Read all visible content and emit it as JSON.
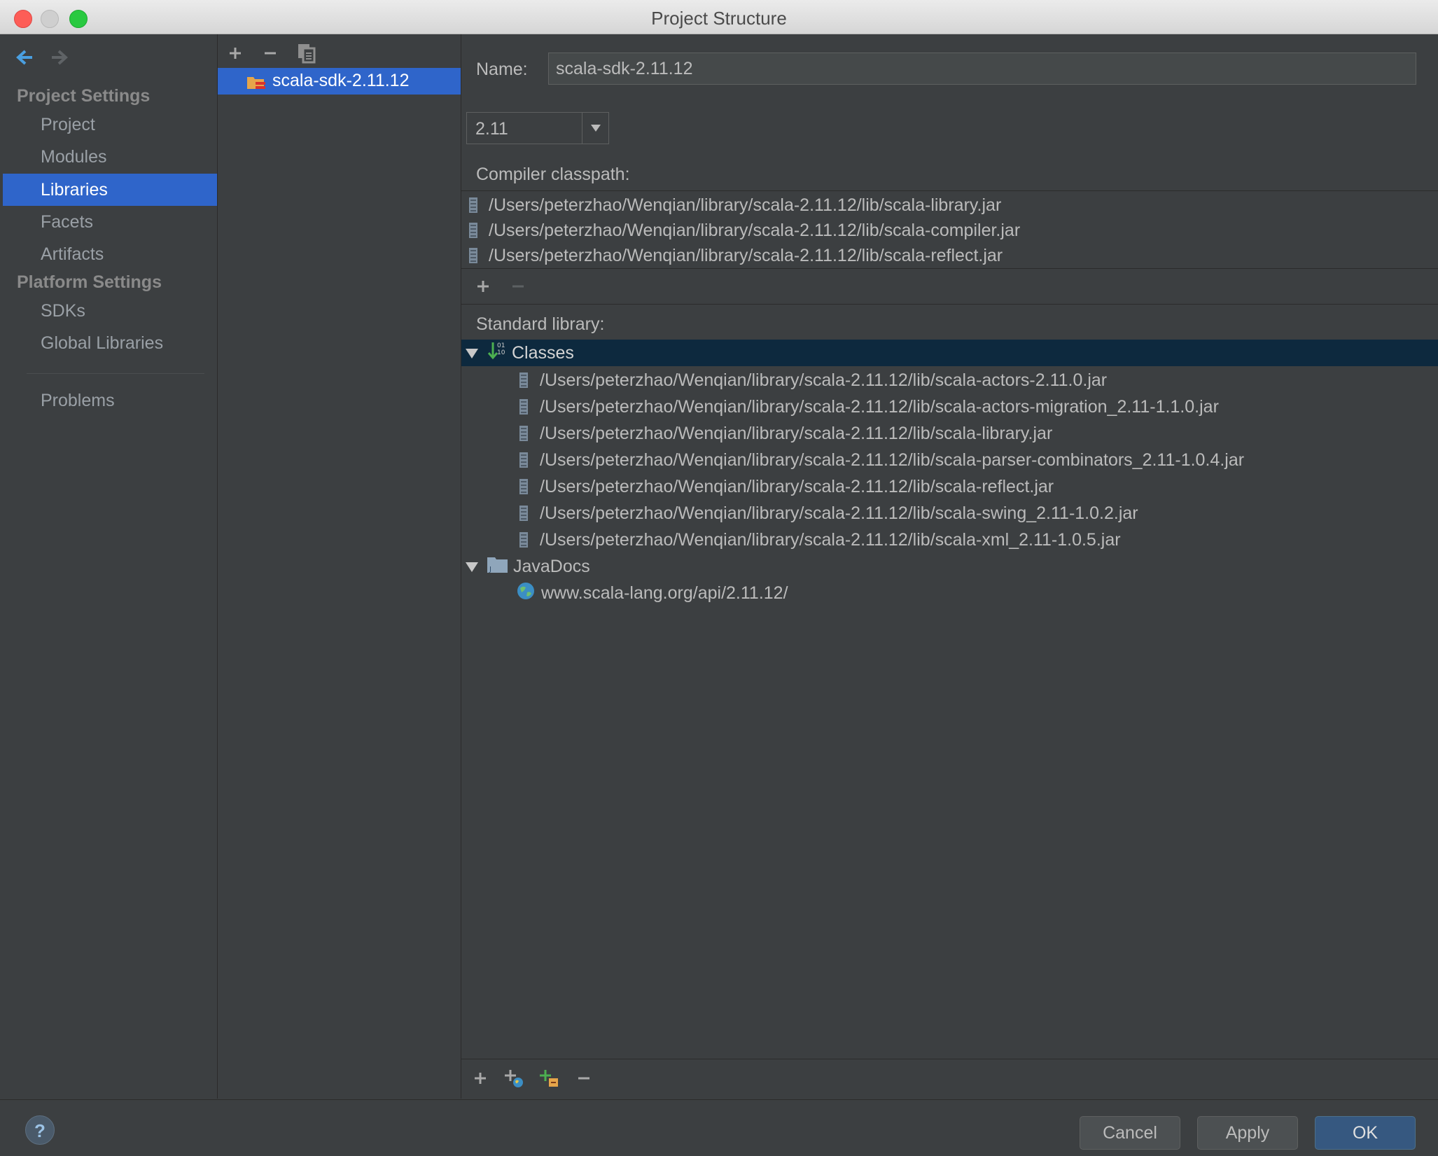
{
  "window": {
    "title": "Project Structure"
  },
  "sidebar": {
    "project_settings_label": "Project Settings",
    "platform_settings_label": "Platform Settings",
    "items": [
      {
        "label": "Project"
      },
      {
        "label": "Modules"
      },
      {
        "label": "Libraries",
        "selected": true
      },
      {
        "label": "Facets"
      },
      {
        "label": "Artifacts"
      },
      {
        "label": "SDKs"
      },
      {
        "label": "Global Libraries"
      },
      {
        "label": "Problems"
      }
    ]
  },
  "library_list": {
    "items": [
      {
        "label": "scala-sdk-2.11.12",
        "selected": true
      }
    ]
  },
  "details": {
    "name_label": "Name:",
    "name_value": "scala-sdk-2.11.12",
    "version_value": "2.11",
    "compiler_classpath_label": "Compiler classpath:",
    "compiler_classpath": [
      "/Users/peterzhao/Wenqian/library/scala-2.11.12/lib/scala-library.jar",
      "/Users/peterzhao/Wenqian/library/scala-2.11.12/lib/scala-compiler.jar",
      "/Users/peterzhao/Wenqian/library/scala-2.11.12/lib/scala-reflect.jar"
    ],
    "standard_library_label": "Standard library:",
    "classes_label": "Classes",
    "classes": [
      "/Users/peterzhao/Wenqian/library/scala-2.11.12/lib/scala-actors-2.11.0.jar",
      "/Users/peterzhao/Wenqian/library/scala-2.11.12/lib/scala-actors-migration_2.11-1.1.0.jar",
      "/Users/peterzhao/Wenqian/library/scala-2.11.12/lib/scala-library.jar",
      "/Users/peterzhao/Wenqian/library/scala-2.11.12/lib/scala-parser-combinators_2.11-1.0.4.jar",
      "/Users/peterzhao/Wenqian/library/scala-2.11.12/lib/scala-reflect.jar",
      "/Users/peterzhao/Wenqian/library/scala-2.11.12/lib/scala-swing_2.11-1.0.2.jar",
      "/Users/peterzhao/Wenqian/library/scala-2.11.12/lib/scala-xml_2.11-1.0.5.jar"
    ],
    "javadocs_label": "JavaDocs",
    "javadocs": [
      "www.scala-lang.org/api/2.11.12/"
    ]
  },
  "footer": {
    "help_label": "?",
    "cancel_label": "Cancel",
    "apply_label": "Apply",
    "ok_label": "OK"
  },
  "colors": {
    "background": "#3c3f41",
    "selection": "#2f65ca",
    "tree_highlight": "#0d293e",
    "ok_button": "#365880"
  }
}
